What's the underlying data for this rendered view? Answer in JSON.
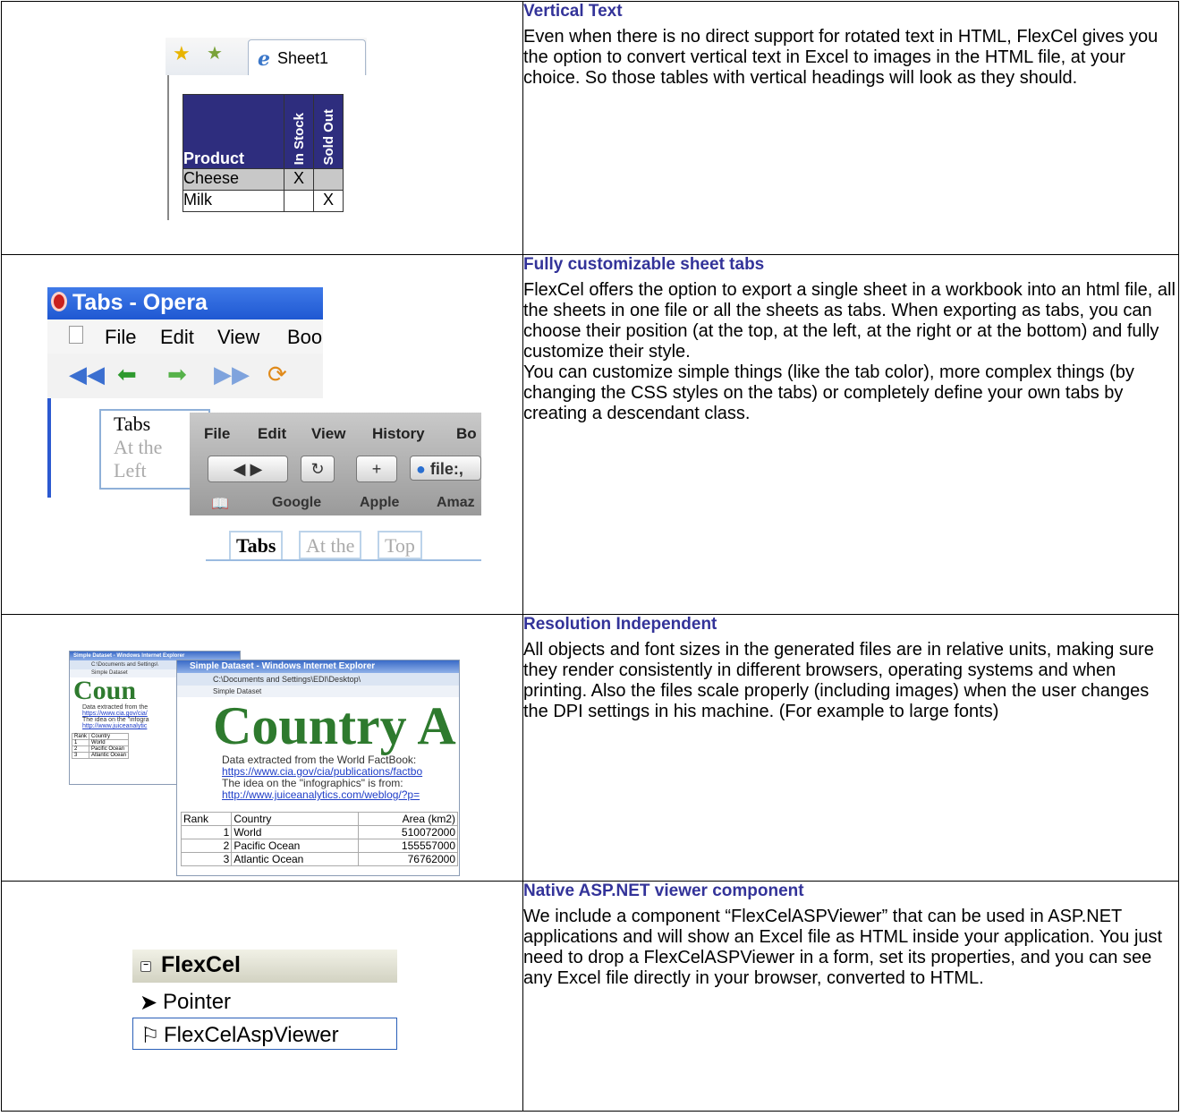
{
  "rows": [
    {
      "title": "Vertical  Text",
      "body": [
        "Even when there is no direct support for rotated text in HTML, FlexCel gives you the option to convert vertical text in Excel to images in the HTML file, at your choice. So those tables with vertical headings will look as they should."
      ]
    },
    {
      "title": "Fully customizable sheet tabs",
      "body": [
        "FlexCel offers the option to export a single sheet in a workbook into an html file, all the sheets in one file or all the sheets as tabs. When exporting as tabs, you can choose their position (at the top, at the left, at the right or at the bottom) and fully customize their style.",
        "You can customize simple things (like the tab color), more complex things (by changing the CSS styles on the tabs) or completely define your own tabs by creating a descendant class."
      ]
    },
    {
      "title": "Resolution Independent",
      "body": [
        "All objects and font sizes in the generated files are in relative units, making sure they render consistently in different browsers, operating systems and when printing. Also the files scale properly (including images) when the user changes the DPI settings in his machine. (For example to large fonts)"
      ]
    },
    {
      "title": "Native ASP.NET viewer component",
      "body": [
        "We include a component “FlexCelASPViewer” that can be used in ASP.NET applications and will show an Excel file as HTML inside your application. You just need to drop a FlexCelASPViewer in a form, set its properties, and you can see any Excel file directly in your browser, converted to HTML."
      ]
    }
  ],
  "vertical_text_image": {
    "tab_label": "Sheet1",
    "headers": [
      "Product",
      "In Stock",
      "Sold Out"
    ],
    "rows": [
      [
        "Cheese",
        "X",
        ""
      ],
      [
        "Milk",
        "",
        "X"
      ]
    ],
    "header_color": "#2e2d7e"
  },
  "tabs_image": {
    "opera_title": "Tabs - Opera",
    "opera_menu": [
      "File",
      "Edit",
      "View",
      "Boo"
    ],
    "opera_tabs": [
      "Tabs",
      "At the",
      "Left"
    ],
    "safari_menu": [
      "File",
      "Edit",
      "View",
      "History",
      "Bo"
    ],
    "safari_address": "file:,",
    "safari_bookmarks": [
      "Google",
      "Apple",
      "Amaz"
    ],
    "safari_tabs": [
      "Tabs",
      "At the",
      "Top"
    ]
  },
  "resolution_image": {
    "small_title": "Simple Dataset - Windows Internet Explorer",
    "small_addr": "C:\\Documents and Settings\\",
    "small_tab": "Simple Dataset",
    "small_heading": "Coun",
    "small_lines": [
      "Data extracted from the",
      "https://www.cia.gov/cia/",
      "The idea on the \"infogra",
      "http://www.juiceanalytic"
    ],
    "small_table": [
      [
        "Rank",
        "Country"
      ],
      [
        "1",
        "World"
      ],
      [
        "2",
        "Pacific Ocean"
      ],
      [
        "3",
        "Atlantic Ocean"
      ]
    ],
    "big_title": "Simple Dataset - Windows Internet Explorer",
    "big_addr": "C:\\Documents and Settings\\EDI\\Desktop\\",
    "big_tab": "Simple Dataset",
    "big_heading": "Country A",
    "big_lines": [
      "Data extracted from the World FactBook:",
      "https://www.cia.gov/cia/publications/factbo",
      "The idea on the \"infographics\" is from:",
      "http://www.juiceanalytics.com/weblog/?p="
    ],
    "big_table_header": [
      "Rank",
      "Country",
      "Area (km2)"
    ],
    "big_table": [
      [
        "1",
        "World",
        "510072000"
      ],
      [
        "2",
        "Pacific Ocean",
        "155557000"
      ],
      [
        "3",
        "Atlantic Ocean",
        "76762000"
      ]
    ]
  },
  "asp_image": {
    "group": "FlexCel",
    "items": [
      "Pointer",
      "FlexCelAspViewer"
    ]
  }
}
